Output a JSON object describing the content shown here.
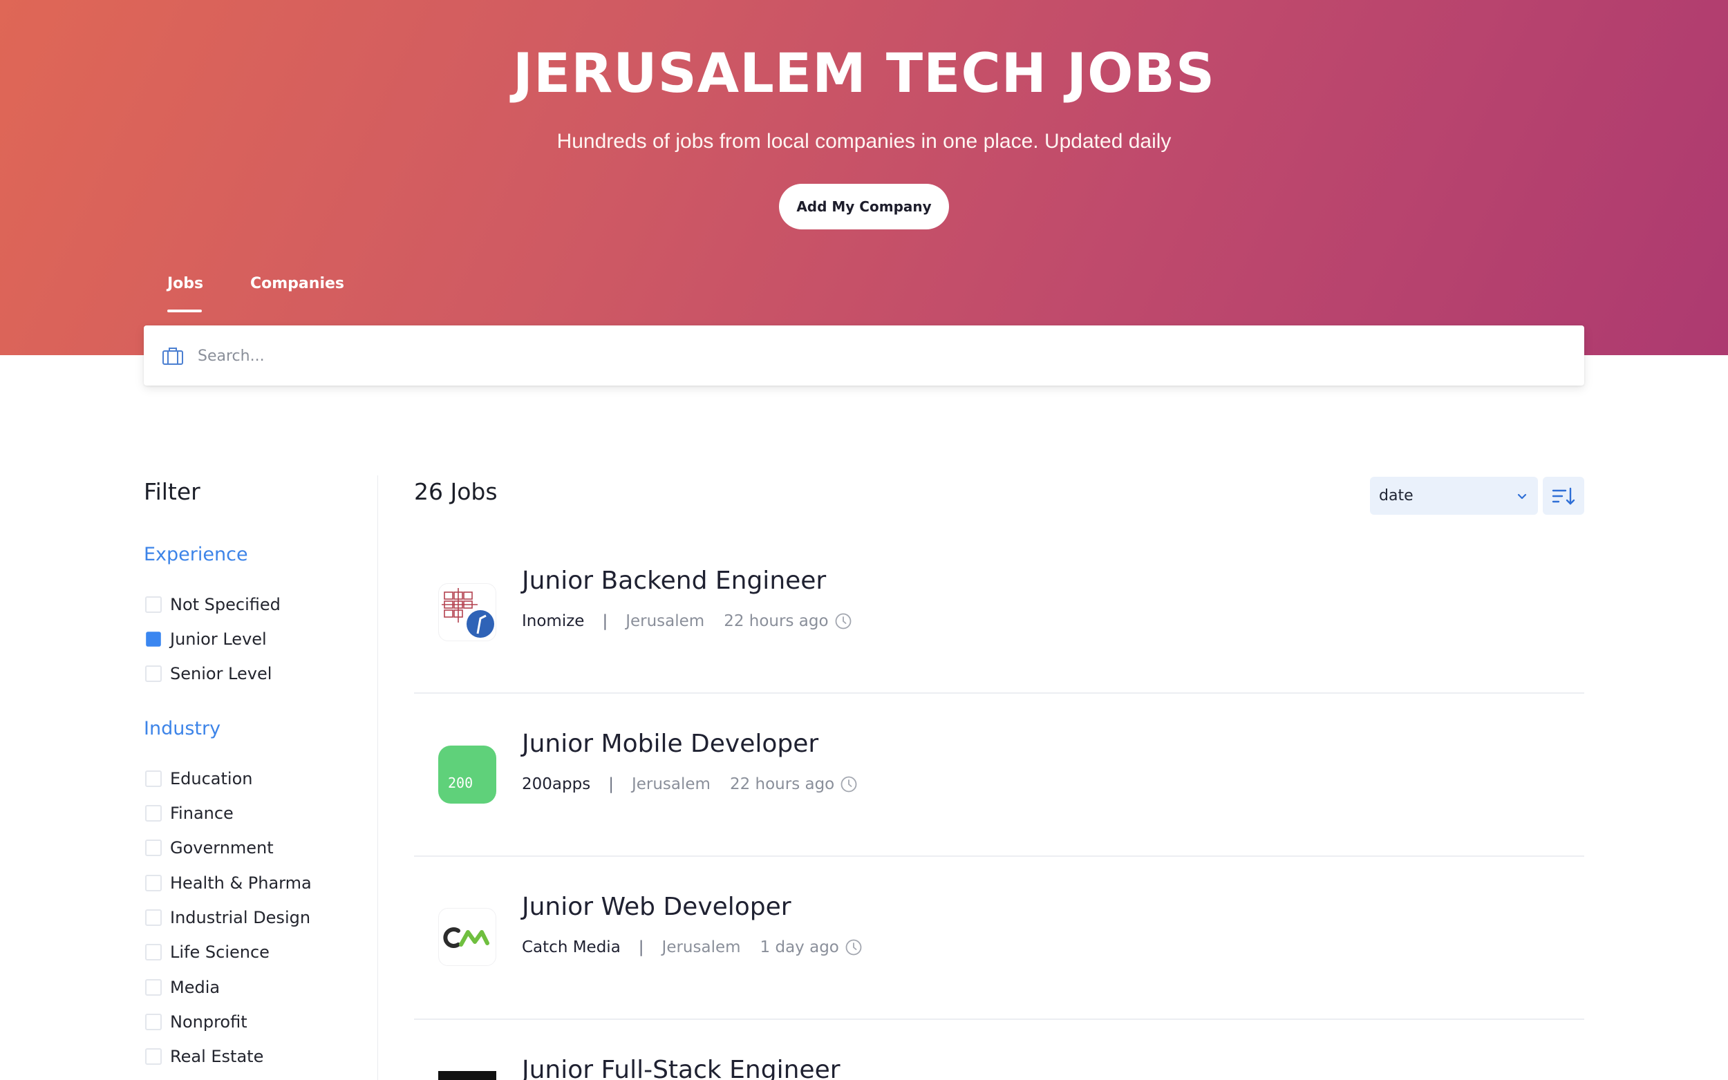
{
  "hero": {
    "title": "JERUSALEM TECH JOBS",
    "subtitle": "Hundreds of jobs from local companies in one place. Updated daily",
    "cta_label": "Add My Company"
  },
  "tabs": [
    {
      "label": "Jobs",
      "active": true
    },
    {
      "label": "Companies",
      "active": false
    }
  ],
  "search": {
    "placeholder": "Search...",
    "value": ""
  },
  "filter": {
    "title": "Filter",
    "groups": [
      {
        "title": "Experience",
        "options": [
          {
            "label": "Not Specified",
            "checked": false
          },
          {
            "label": "Junior Level",
            "checked": true
          },
          {
            "label": "Senior Level",
            "checked": false
          }
        ]
      },
      {
        "title": "Industry",
        "options": [
          {
            "label": "Education",
            "checked": false
          },
          {
            "label": "Finance",
            "checked": false
          },
          {
            "label": "Government",
            "checked": false
          },
          {
            "label": "Health & Pharma",
            "checked": false
          },
          {
            "label": "Industrial Design",
            "checked": false
          },
          {
            "label": "Life Science",
            "checked": false
          },
          {
            "label": "Media",
            "checked": false
          },
          {
            "label": "Nonprofit",
            "checked": false
          },
          {
            "label": "Real Estate",
            "checked": false
          }
        ]
      }
    ]
  },
  "results": {
    "count_label": "26 Jobs",
    "sort": {
      "value": "date",
      "direction_icon": "sort-descending-icon"
    }
  },
  "jobs": [
    {
      "title": "Junior Backend Engineer",
      "company": "Inomize",
      "location": "Jerusalem",
      "posted": "22 hours ago",
      "logo": "inomize-logo"
    },
    {
      "title": "Junior Mobile Developer",
      "company": "200apps",
      "location": "Jerusalem",
      "posted": "22 hours ago",
      "logo": "200apps-logo",
      "logo_text": "200"
    },
    {
      "title": "Junior Web Developer",
      "company": "Catch Media",
      "location": "Jerusalem",
      "posted": "1 day ago",
      "logo": "catch-media-logo"
    },
    {
      "title": "Junior Full-Stack Engineer",
      "company": "",
      "location": "",
      "posted": "",
      "logo": "black-logo"
    }
  ],
  "colors": {
    "accent_blue": "#3d84e8",
    "hero_start": "#df6756",
    "hero_end": "#ad3a70",
    "logo_green": "#5fd17a"
  }
}
